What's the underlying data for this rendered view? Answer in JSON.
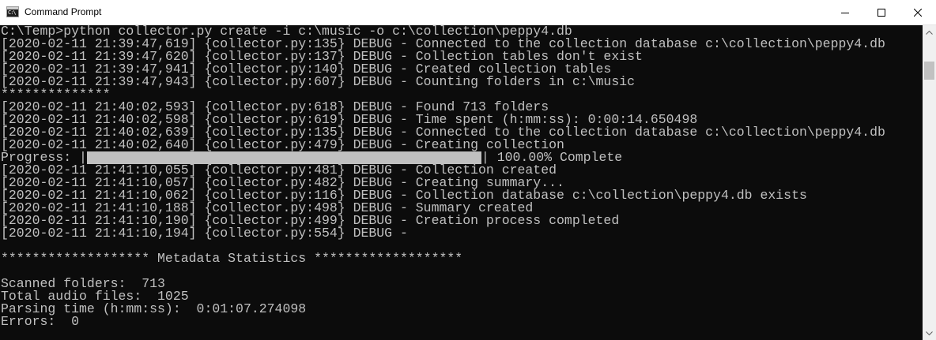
{
  "window": {
    "title": "Command Prompt",
    "icon": "cmd-icon"
  },
  "console": {
    "lines": [
      "C:\\Temp>python collector.py create -i c:\\music -o c:\\collection\\peppy4.db",
      "[2020-02-11 21:39:47,619] {collector.py:135} DEBUG - Connected to the collection database c:\\collection\\peppy4.db",
      "[2020-02-11 21:39:47,620] {collector.py:137} DEBUG - Collection tables don't exist",
      "[2020-02-11 21:39:47,941] {collector.py:140} DEBUG - Created collection tables",
      "[2020-02-11 21:39:47,943] {collector.py:607} DEBUG - Counting folders in c:\\music",
      "**************",
      "[2020-02-11 21:40:02,593] {collector.py:618} DEBUG - Found 713 folders",
      "[2020-02-11 21:40:02,598] {collector.py:619} DEBUG - Time spent (h:mm:ss): 0:00:14.650498",
      "[2020-02-11 21:40:02,639] {collector.py:135} DEBUG - Connected to the collection database c:\\collection\\peppy4.db",
      "[2020-02-11 21:40:02,640] {collector.py:479} DEBUG - Creating collection"
    ],
    "progress": {
      "label": "Progress: |",
      "end": "| 100.00% Complete",
      "fraction": 1.0
    },
    "lines_after": [
      "[2020-02-11 21:41:10,055] {collector.py:481} DEBUG - Collection created",
      "[2020-02-11 21:41:10,057] {collector.py:482} DEBUG - Creating summary...",
      "[2020-02-11 21:41:10,062] {collector.py:116} DEBUG - Collection database c:\\collection\\peppy4.db exists",
      "[2020-02-11 21:41:10,188] {collector.py:498} DEBUG - Summary created",
      "[2020-02-11 21:41:10,190] {collector.py:499} DEBUG - Creation process completed",
      "[2020-02-11 21:41:10,194] {collector.py:554} DEBUG -",
      "",
      "******************* Metadata Statistics *******************",
      "",
      "Scanned folders:  713",
      "Total audio files:  1025",
      "Parsing time (h:mm:ss):  0:01:07.274098",
      "Errors:  0"
    ]
  },
  "colors": {
    "console_bg": "#0c0c0c",
    "console_fg": "#c0c0c0",
    "titlebar_bg": "#ffffff"
  }
}
